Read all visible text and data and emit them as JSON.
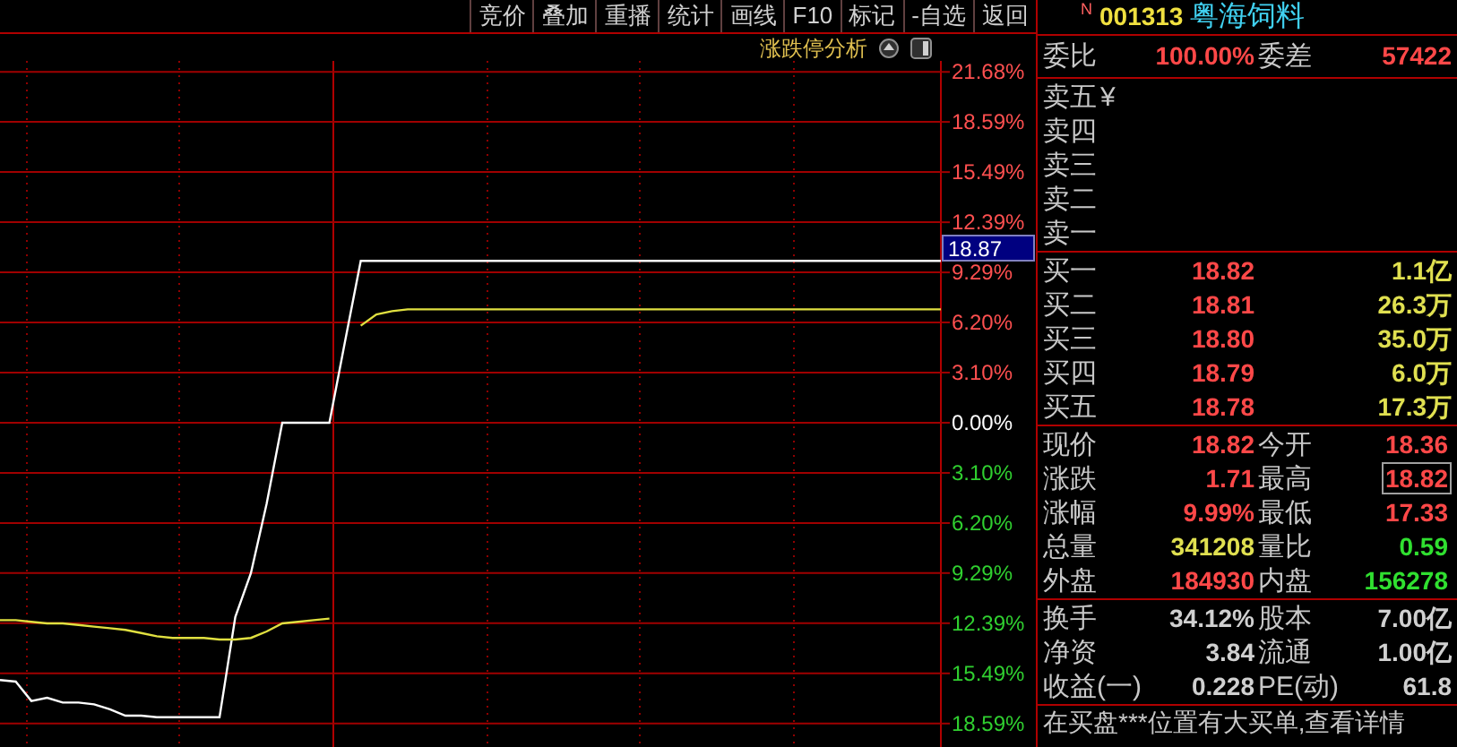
{
  "toolbar": [
    {
      "label": "竞价"
    },
    {
      "label": "叠加"
    },
    {
      "label": "重播"
    },
    {
      "label": "统计"
    },
    {
      "label": "画线"
    },
    {
      "label": "F10"
    },
    {
      "label": "标记"
    },
    {
      "label": "-自选"
    },
    {
      "label": "返回"
    }
  ],
  "chart_header": {
    "title": "涨跌停分析"
  },
  "chart": {
    "cursor_price": "18.87",
    "chart_data": {
      "type": "line",
      "ylim": [
        -20.04,
        22.36
      ],
      "grid": true,
      "categories": [
        null,
        null,
        null,
        null,
        null,
        null,
        null,
        null,
        null,
        null,
        null,
        null,
        null,
        null,
        null,
        null,
        null,
        null,
        null,
        null,
        null,
        null,
        null,
        null,
        null,
        null,
        null,
        null,
        null,
        null,
        null,
        null,
        null,
        null,
        null,
        null,
        null,
        null,
        null,
        null,
        null,
        null,
        null,
        null,
        null,
        null,
        null,
        null,
        null,
        null,
        null,
        null,
        null,
        null,
        null,
        null,
        null,
        null,
        null,
        null,
        null
      ],
      "series": [
        {
          "color": "#ffffff",
          "values": [
            -15.9,
            -16.0,
            -17.2,
            -17.0,
            -17.3,
            -17.3,
            -17.4,
            -17.7,
            -18.1,
            -18.1,
            -18.2,
            -18.2,
            -18.2,
            -18.2,
            -18.2,
            -12.0,
            -9.3,
            -5.0,
            0,
            0,
            0,
            0,
            5.0,
            10.0,
            10.0,
            10.0,
            10.0,
            10.0,
            10.0,
            10.0,
            10.0,
            10.0,
            10.0,
            10.0,
            10.0,
            10.0,
            10.0,
            10.0,
            10.0,
            10.0,
            10.0,
            10.0,
            10.0,
            10.0,
            10.0,
            10.0,
            10.0,
            10.0,
            10.0,
            10.0,
            10.0,
            10.0,
            10.0,
            10.0,
            10.0,
            10.0,
            10.0,
            10.0,
            10.0,
            10.0,
            10.0
          ]
        },
        {
          "color": "#e0e040",
          "values": [
            -12.2,
            -12.2,
            -12.3,
            -12.4,
            -12.4,
            -12.5,
            -12.6,
            -12.7,
            -12.8,
            -13.0,
            -13.2,
            -13.3,
            -13.3,
            -13.3,
            -13.4,
            -13.4,
            -13.3,
            -12.9,
            -12.4,
            -12.3,
            -12.2,
            -12.1,
            null,
            6.0,
            6.7,
            6.9,
            7.0,
            7.0,
            7.0,
            7.0,
            7.0,
            7.0,
            7.0,
            7.0,
            7.0,
            7.0,
            7.0,
            7.0,
            7.0,
            7.0,
            7.0,
            7.0,
            7.0,
            7.0,
            7.0,
            7.0,
            7.0,
            7.0,
            7.0,
            7.0,
            7.0,
            7.0,
            7.0,
            7.0,
            7.0,
            7.0,
            7.0,
            7.0,
            7.0,
            7.0,
            7.0
          ]
        }
      ],
      "yticks": [
        {
          "value": 21.68,
          "label": "21.68%"
        },
        {
          "value": 18.59,
          "label": "18.59%"
        },
        {
          "value": 15.49,
          "label": "15.49%"
        },
        {
          "value": 12.39,
          "label": "12.39%"
        },
        {
          "value": 9.29,
          "label": "9.29%"
        },
        {
          "value": 6.2,
          "label": "6.20%"
        },
        {
          "value": 3.1,
          "label": "3.10%"
        },
        {
          "value": 0,
          "label": "0.00%"
        },
        {
          "value": -3.1,
          "label": "3.10%"
        },
        {
          "value": -6.2,
          "label": "6.20%"
        },
        {
          "value": -9.29,
          "label": "9.29%"
        },
        {
          "value": -12.39,
          "label": "12.39%"
        },
        {
          "value": -15.49,
          "label": "15.49%"
        },
        {
          "value": -18.59,
          "label": "18.59%"
        }
      ]
    }
  },
  "quote": {
    "flag": "N",
    "code": "001313",
    "name": "粤海饲料",
    "order_ratio": {
      "label": "委比",
      "value": "100.00%",
      "diff_label": "委差",
      "diff_value": "57422"
    },
    "asks": [
      {
        "label": "卖五",
        "currency": "¥"
      },
      {
        "label": "卖四"
      },
      {
        "label": "卖三"
      },
      {
        "label": "卖二"
      },
      {
        "label": "卖一"
      }
    ],
    "bids": [
      {
        "label": "买一",
        "price": "18.82",
        "volume": "1.1亿"
      },
      {
        "label": "买二",
        "price": "18.81",
        "volume": "26.3万"
      },
      {
        "label": "买三",
        "price": "18.80",
        "volume": "35.0万"
      },
      {
        "label": "买四",
        "price": "18.79",
        "volume": "6.0万"
      },
      {
        "label": "买五",
        "price": "18.78",
        "volume": "17.3万"
      }
    ],
    "stats": [
      {
        "left": {
          "label": "现价",
          "value": "18.82",
          "color": "#ff4848"
        },
        "right": {
          "label": "今开",
          "value": "18.36",
          "color": "#ff4848",
          "highlighted": false
        }
      },
      {
        "left": {
          "label": "涨跌",
          "value": "1.71",
          "color": "#ff4848"
        },
        "right": {
          "label": "最高",
          "value": "18.82",
          "color": "#ff4848",
          "highlighted": true
        }
      },
      {
        "left": {
          "label": "涨幅",
          "value": "9.99%",
          "color": "#ff4848"
        },
        "right": {
          "label": "最低",
          "value": "17.33",
          "color": "#ff4848",
          "highlighted": false
        }
      },
      {
        "left": {
          "label": "总量",
          "value": "341208",
          "color": "#e0e050"
        },
        "right": {
          "label": "量比",
          "value": "0.59",
          "color": "#30e030",
          "highlighted": false
        }
      },
      {
        "left": {
          "label": "外盘",
          "value": "184930",
          "color": "#ff4848"
        },
        "right": {
          "label": "内盘",
          "value": "156278",
          "color": "#30e030",
          "highlighted": false
        }
      }
    ],
    "fundamentals": [
      {
        "label": "换手",
        "value": "34.12%",
        "label2": "股本",
        "value2": "7.00亿"
      },
      {
        "label": "净资",
        "value": "3.84",
        "label2": "流通",
        "value2": "1.00亿"
      },
      {
        "label": "收益(一)",
        "value": "0.228",
        "label2": "PE(动)",
        "value2": "61.8"
      }
    ],
    "notice": "在买盘***位置有大买单,查看详情"
  }
}
